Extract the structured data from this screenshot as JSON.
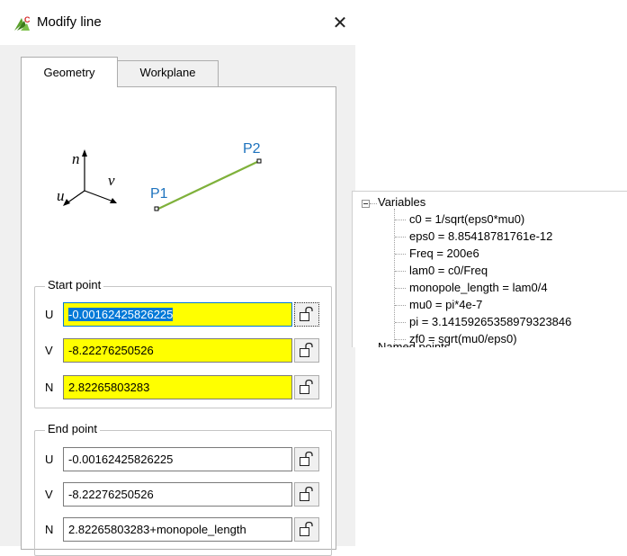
{
  "window": {
    "title": "Modify line",
    "close_glyph": "✕",
    "app_icon": "cst-app-icon"
  },
  "tabs": [
    {
      "label": "Geometry",
      "active": true
    },
    {
      "label": "Workplane",
      "active": false
    }
  ],
  "diagram": {
    "axis_n": "n",
    "axis_v": "v",
    "axis_u": "u",
    "point1": "P1",
    "point2": "P2",
    "line_color": "#7fb13b",
    "label_color": "#1e73be"
  },
  "start_point": {
    "label": "Start point",
    "u_label": "U",
    "u_value": "-0.00162425826225",
    "v_label": "V",
    "v_value": "-8.22276250526",
    "n_label": "N",
    "n_value": "2.82265803283"
  },
  "end_point": {
    "label": "End point",
    "u_label": "U",
    "u_value": "-0.00162425826225",
    "v_label": "V",
    "v_value": "-8.22276250526",
    "n_label": "N",
    "n_value": "2.82265803283+monopole_length"
  },
  "variables_tree": {
    "root": "Variables",
    "items": [
      "c0 = 1/sqrt(eps0*mu0)",
      "eps0 = 8.85418781761e-12",
      "Freq = 200e6",
      "lam0 = c0/Freq",
      "monopole_length = lam0/4",
      "mu0 = pi*4e-7",
      "pi = 3.1415926535897932384​6",
      "zf0 = sqrt(mu0/eps0)"
    ],
    "next_partial": "Named points"
  },
  "colors": {
    "highlight": "#ffff00",
    "selection": "#0078d7",
    "focus_border": "#0078d7"
  }
}
